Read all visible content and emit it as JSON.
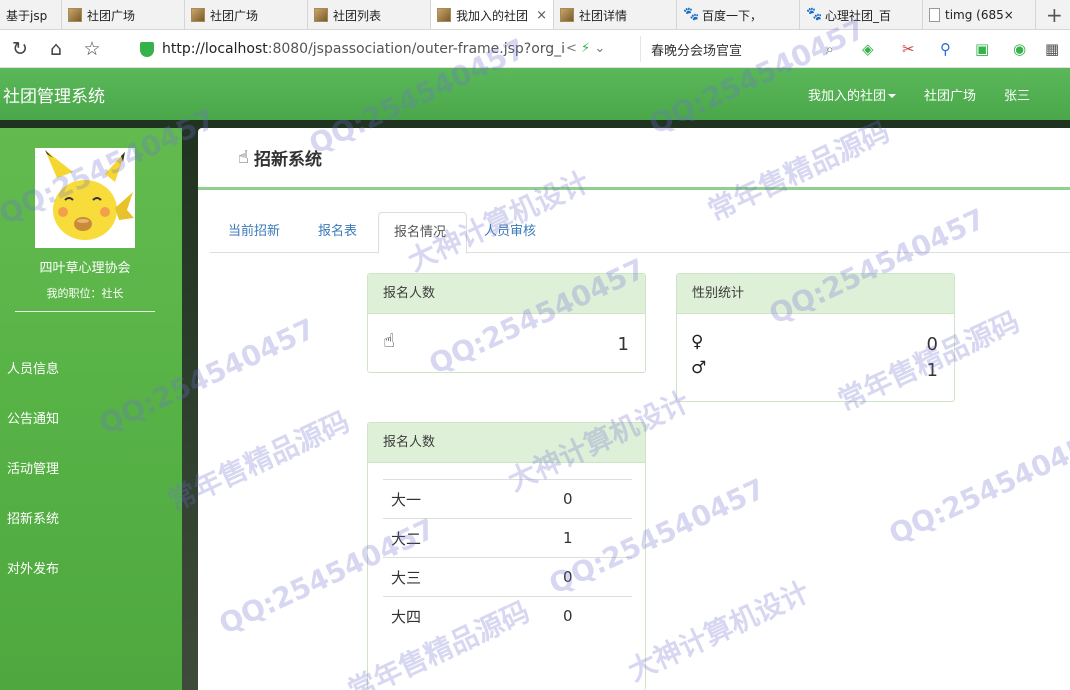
{
  "browser": {
    "tabs": [
      {
        "label": "基于jsp",
        "icon": "page-favicon"
      },
      {
        "label": "社团广场",
        "icon": "page-favicon"
      },
      {
        "label": "社团广场",
        "icon": "page-favicon"
      },
      {
        "label": "社团列表",
        "icon": "page-favicon"
      },
      {
        "label": "我加入的社团",
        "icon": "page-favicon",
        "close": "×"
      },
      {
        "label": "社团详情",
        "icon": "page-favicon"
      },
      {
        "label": "百度一下，",
        "icon": "baidu-paw-icon"
      },
      {
        "label": "心理社团_百",
        "icon": "baidu-paw-icon"
      },
      {
        "label": "timg (685×",
        "icon": "document-icon"
      }
    ],
    "url_host": "http://localhost",
    "url_rest": ":8080/jspassociation/outer-frame.jsp?org_i",
    "search_text": "春晚分会场官宣"
  },
  "app": {
    "brand": "社团管理系统",
    "nav": {
      "my_clubs": "我加入的社团",
      "square": "社团广场",
      "user": "张三"
    }
  },
  "sidebar": {
    "org_name": "四叶草心理协会",
    "role": "我的职位：社长",
    "menu": [
      {
        "label": "人员信息"
      },
      {
        "label": "公告通知"
      },
      {
        "label": "活动管理"
      },
      {
        "label": "招新系统"
      },
      {
        "label": "对外发布"
      }
    ]
  },
  "main": {
    "title": "招新系统",
    "tabs": [
      {
        "label": "当前招新"
      },
      {
        "label": "报名表"
      },
      {
        "label": "报名情况"
      },
      {
        "label": "人员审核"
      }
    ],
    "card_count": {
      "title": "报名人数",
      "value": "1"
    },
    "card_gender": {
      "title": "性别统计",
      "female": "0",
      "male": "1"
    },
    "card_grade": {
      "title": "报名人数",
      "rows": [
        {
          "grade": "大一",
          "count": "0"
        },
        {
          "grade": "大二",
          "count": "1"
        },
        {
          "grade": "大三",
          "count": "0"
        },
        {
          "grade": "大四",
          "count": "0"
        }
      ]
    }
  },
  "watermarks": {
    "qq": "QQ:254540457",
    "sell": "常年售精品源码",
    "design": "大神计算机设计"
  },
  "colors": {
    "header_green": "#4aa84a",
    "sidebar_green": "#57b246",
    "card_head": "#dff0d8",
    "link_blue": "#3a7ab8"
  }
}
